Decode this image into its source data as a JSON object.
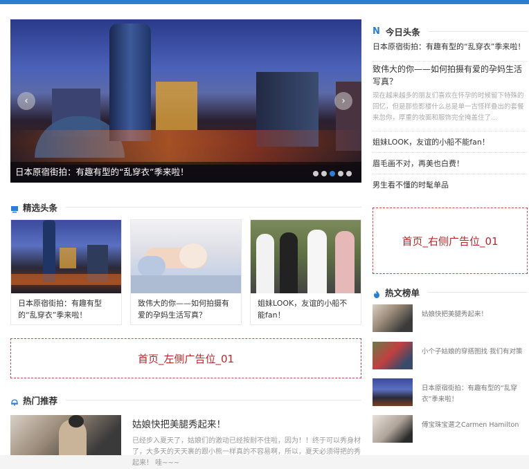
{
  "slider": {
    "caption": "日本原宿街拍：有趣有型的“乱穿衣”季来啦！",
    "prev": "‹",
    "next": "›",
    "dots": 4,
    "active_dot": 3
  },
  "featured": {
    "title": "精选头条",
    "items": [
      {
        "text": "日本原宿街拍：有趣有型的“乱穿衣”季来啦！"
      },
      {
        "text": "致伟大的你——如何拍摄有爱的孕妈生活写真？"
      },
      {
        "text": "姐妹LOOK，友谊的小船不能fan！"
      }
    ]
  },
  "ads": {
    "left": "首页_左侧广告位_01",
    "right": "首页_右侧广告位_01"
  },
  "hot_recommend": {
    "title": "热门推荐",
    "item_title": "姑娘快把美腿秀起来！",
    "item_desc": "已经步入夏天了，姑娘们的激动已经按耐不住啦，因为！！终于可以秀身材了，大多天的天天裹的跟小熊一样真的不容易啊，所以，夏天必须得把的秀起来！ 哇~~~"
  },
  "today": {
    "icon": "N",
    "title": "今日头条",
    "first": "日本原宿街拍：有趣有型的“乱穿衣”季来啦！",
    "feature_title": "致伟大的你——如何拍摄有爱的孕妈生活写真？",
    "feature_desc": "现在越来越多的朋友们喜欢在怀孕的时候留下特殊的回忆，但是那些影楼什么总是单一古怪样叠出的套餐来忽你，厚重的妆面和服饰完全掩盖住了...",
    "rows": [
      "姐妹LOOK，友谊的小船不能fan！",
      "眉毛画不对，再美也白费！",
      "男生看不懂的时髦单品"
    ]
  },
  "hot_rank": {
    "title": "热文榜单",
    "items": [
      {
        "text": "姑娘快把美腿秀起来！"
      },
      {
        "text": "小个子姑娘的穿搭图找 我们有对策"
      },
      {
        "text": "日本原宿街拍：有趣有型的“乱穿衣”季来啦！"
      },
      {
        "text": "傅宝珠宝選之Carmen Hamilton"
      }
    ]
  },
  "colors": {
    "accent": "#2a7fd4",
    "ad": "#b8262b"
  }
}
